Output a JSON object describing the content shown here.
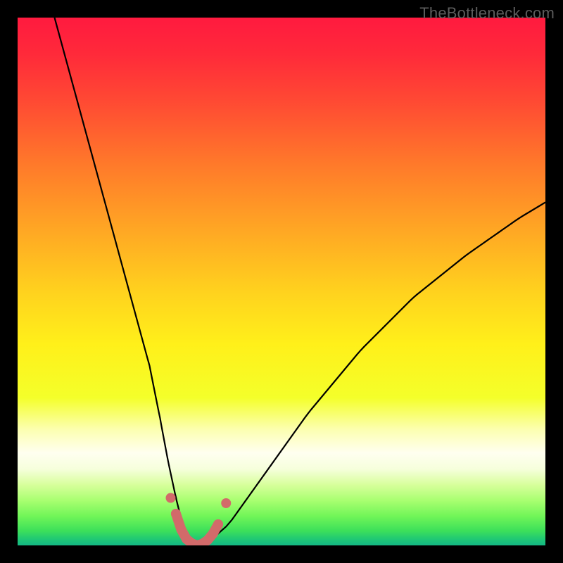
{
  "watermark": "TheBottleneck.com",
  "chart_data": {
    "type": "line",
    "title": "",
    "xlabel": "",
    "ylabel": "",
    "xlim": [
      0,
      100
    ],
    "ylim": [
      0,
      100
    ],
    "grid": false,
    "series": [
      {
        "name": "bottleneck-curve",
        "type": "line",
        "x": [
          7,
          10,
          13,
          16,
          19,
          22,
          25,
          27,
          28.5,
          30,
          31,
          32,
          33,
          34,
          35,
          36,
          40,
          45,
          50,
          55,
          60,
          65,
          70,
          75,
          80,
          85,
          90,
          95,
          100
        ],
        "y": [
          100,
          89,
          78,
          67,
          56,
          45,
          34,
          24,
          16,
          9,
          5,
          2,
          0.5,
          0,
          0,
          0.5,
          4,
          11,
          18,
          25,
          31,
          37,
          42,
          47,
          51,
          55,
          58.5,
          62,
          65
        ]
      },
      {
        "name": "highlight-segment",
        "type": "line-thick",
        "x": [
          30,
          31,
          32,
          33,
          34,
          35,
          36,
          37,
          38
        ],
        "y": [
          6,
          3,
          1.2,
          0.4,
          0,
          0.3,
          1,
          2.2,
          4
        ]
      },
      {
        "name": "highlight-dots",
        "type": "scatter",
        "x": [
          29,
          30,
          31,
          32,
          33,
          34,
          35,
          36,
          37,
          38,
          39.5
        ],
        "y": [
          9,
          6,
          3,
          1.2,
          0.4,
          0,
          0.3,
          1,
          2.2,
          4,
          8
        ]
      }
    ],
    "gradient_stops": [
      {
        "offset": 0.0,
        "color": "#ff1a3f"
      },
      {
        "offset": 0.07,
        "color": "#ff2a3a"
      },
      {
        "offset": 0.16,
        "color": "#ff4a33"
      },
      {
        "offset": 0.28,
        "color": "#ff7a2a"
      },
      {
        "offset": 0.4,
        "color": "#ffa624"
      },
      {
        "offset": 0.52,
        "color": "#ffd21e"
      },
      {
        "offset": 0.62,
        "color": "#fff01a"
      },
      {
        "offset": 0.72,
        "color": "#f4ff2a"
      },
      {
        "offset": 0.78,
        "color": "#fcffb0"
      },
      {
        "offset": 0.825,
        "color": "#fffff0"
      },
      {
        "offset": 0.855,
        "color": "#f6ffdc"
      },
      {
        "offset": 0.885,
        "color": "#d8ff9c"
      },
      {
        "offset": 0.915,
        "color": "#a8ff70"
      },
      {
        "offset": 0.945,
        "color": "#70f558"
      },
      {
        "offset": 0.972,
        "color": "#3de05a"
      },
      {
        "offset": 0.988,
        "color": "#20c874"
      },
      {
        "offset": 1.0,
        "color": "#14b884"
      }
    ],
    "curve_color": "#000000",
    "highlight_color": "#d26a6a"
  }
}
